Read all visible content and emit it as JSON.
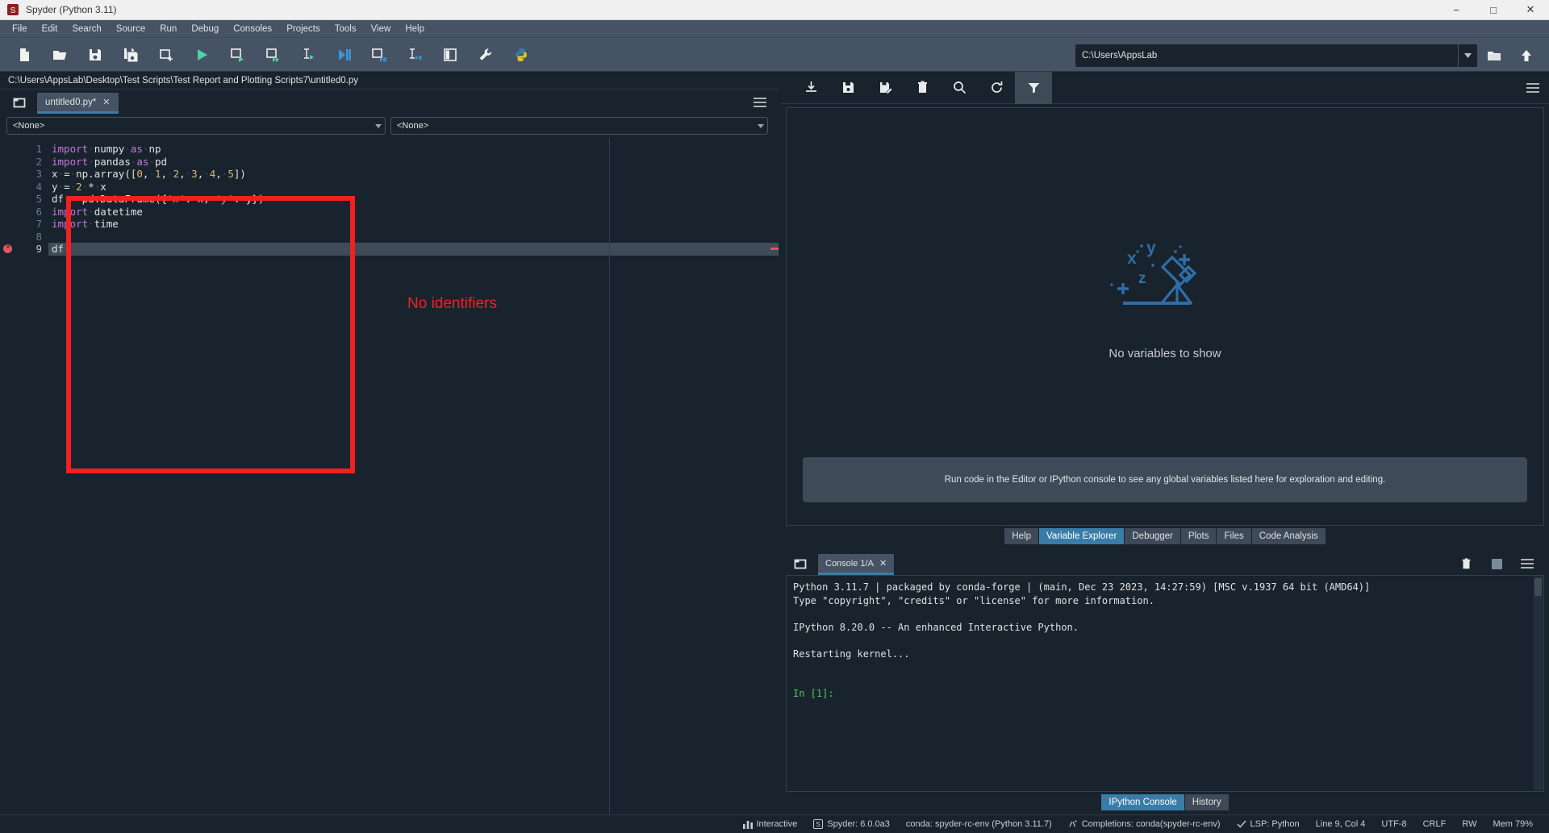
{
  "window": {
    "title": "Spyder (Python 3.11)",
    "app_icon": "spyder-icon",
    "minimize": "−",
    "maximize": "□",
    "close": "✕"
  },
  "menubar": {
    "items": [
      {
        "label": "File",
        "name": "menu-file"
      },
      {
        "label": "Edit",
        "name": "menu-edit"
      },
      {
        "label": "Search",
        "name": "menu-search"
      },
      {
        "label": "Source",
        "name": "menu-source"
      },
      {
        "label": "Run",
        "name": "menu-run"
      },
      {
        "label": "Debug",
        "name": "menu-debug"
      },
      {
        "label": "Consoles",
        "name": "menu-consoles"
      },
      {
        "label": "Projects",
        "name": "menu-projects"
      },
      {
        "label": "Tools",
        "name": "menu-tools"
      },
      {
        "label": "View",
        "name": "menu-view"
      },
      {
        "label": "Help",
        "name": "menu-help"
      }
    ]
  },
  "toolbar": {
    "buttons": [
      "new-file-icon",
      "open-file-icon",
      "save-file-icon",
      "save-all-icon",
      "new-cell-icon",
      "run-file-icon",
      "run-cell-icon",
      "run-cell-advance-icon",
      "run-selection-icon",
      "debug-file-icon",
      "debug-cell-icon",
      "debug-selection-icon",
      "maximize-pane-icon",
      "preferences-icon",
      "python-path-manager-icon"
    ],
    "path_value": "C:\\Users\\AppsLab",
    "browse_icon": "open-folder-icon",
    "parent_icon": "go-up-icon"
  },
  "editor": {
    "file_path": "C:\\Users\\AppsLab\\Desktop\\Test Scripts\\Test Report and Plotting Scripts7\\untitled0.py",
    "corner_icon": "browse-tabs-icon",
    "options_icon": "hamburger-menu-icon",
    "tab": {
      "label": "untitled0.py*",
      "close": "✕"
    },
    "class_selector": "<None>",
    "function_selector": "<None>",
    "status_line": "Line 9, Col 4",
    "lines": [
      {
        "no": "1",
        "tokens": [
          {
            "t": "import",
            "c": "kw"
          },
          {
            "t": "·",
            "c": "ind"
          },
          {
            "t": "numpy",
            "c": "pl"
          },
          {
            "t": "·",
            "c": "ind"
          },
          {
            "t": "as",
            "c": "kw"
          },
          {
            "t": "·",
            "c": "ind"
          },
          {
            "t": "np",
            "c": "pl"
          }
        ]
      },
      {
        "no": "2",
        "tokens": [
          {
            "t": "import",
            "c": "kw"
          },
          {
            "t": "·",
            "c": "ind"
          },
          {
            "t": "pandas",
            "c": "pl"
          },
          {
            "t": "·",
            "c": "ind"
          },
          {
            "t": "as",
            "c": "kw"
          },
          {
            "t": "·",
            "c": "ind"
          },
          {
            "t": "pd",
            "c": "pl"
          }
        ]
      },
      {
        "no": "3",
        "tokens": [
          {
            "t": "x",
            "c": "pl"
          },
          {
            "t": "·",
            "c": "ind"
          },
          {
            "t": "=",
            "c": "op"
          },
          {
            "t": "·",
            "c": "ind"
          },
          {
            "t": "np.array([",
            "c": "pl"
          },
          {
            "t": "0",
            "c": "num"
          },
          {
            "t": ",",
            "c": "op"
          },
          {
            "t": "·",
            "c": "ind"
          },
          {
            "t": "1",
            "c": "num"
          },
          {
            "t": ",",
            "c": "op"
          },
          {
            "t": "·",
            "c": "ind"
          },
          {
            "t": "2",
            "c": "num"
          },
          {
            "t": ",",
            "c": "op"
          },
          {
            "t": "·",
            "c": "ind"
          },
          {
            "t": "3",
            "c": "num"
          },
          {
            "t": ",",
            "c": "op"
          },
          {
            "t": "·",
            "c": "ind"
          },
          {
            "t": "4",
            "c": "num"
          },
          {
            "t": ",",
            "c": "op"
          },
          {
            "t": "·",
            "c": "ind"
          },
          {
            "t": "5",
            "c": "num"
          },
          {
            "t": "])",
            "c": "pl"
          }
        ]
      },
      {
        "no": "4",
        "tokens": [
          {
            "t": "y",
            "c": "pl"
          },
          {
            "t": "·",
            "c": "ind"
          },
          {
            "t": "=",
            "c": "op"
          },
          {
            "t": "·",
            "c": "ind"
          },
          {
            "t": "2",
            "c": "num"
          },
          {
            "t": "·",
            "c": "ind"
          },
          {
            "t": "*",
            "c": "op"
          },
          {
            "t": "·",
            "c": "ind"
          },
          {
            "t": "x",
            "c": "pl"
          }
        ]
      },
      {
        "no": "5",
        "tokens": [
          {
            "t": "df",
            "c": "pl"
          },
          {
            "t": "·",
            "c": "ind"
          },
          {
            "t": "=",
            "c": "op"
          },
          {
            "t": "·",
            "c": "ind"
          },
          {
            "t": "pd.DataFrame({",
            "c": "pl"
          },
          {
            "t": "'x'",
            "c": "str"
          },
          {
            "t": ":",
            "c": "op"
          },
          {
            "t": "·",
            "c": "ind"
          },
          {
            "t": "x,",
            "c": "pl"
          },
          {
            "t": "·",
            "c": "ind"
          },
          {
            "t": "'y'",
            "c": "str"
          },
          {
            "t": ":",
            "c": "op"
          },
          {
            "t": "·",
            "c": "ind"
          },
          {
            "t": "y})",
            "c": "pl"
          }
        ]
      },
      {
        "no": "6",
        "tokens": [
          {
            "t": "import",
            "c": "kw"
          },
          {
            "t": "·",
            "c": "ind"
          },
          {
            "t": "datetime",
            "c": "pl"
          }
        ]
      },
      {
        "no": "7",
        "tokens": [
          {
            "t": "import",
            "c": "kw"
          },
          {
            "t": "·",
            "c": "ind"
          },
          {
            "t": "time",
            "c": "pl"
          }
        ]
      },
      {
        "no": "8",
        "tokens": []
      },
      {
        "no": "9",
        "tokens": [
          {
            "t": "df.",
            "c": "pl"
          }
        ],
        "current": true,
        "error": true
      }
    ]
  },
  "annotation": {
    "label": "No identifiers",
    "color": "#f22020"
  },
  "variable_explorer": {
    "toolbar": [
      "import-data-icon",
      "save-data-icon",
      "save-data-as-icon",
      "remove-all-variables-icon",
      "search-icon",
      "refresh-icon",
      "filter-icon"
    ],
    "active_tool": "filter-icon",
    "options_icon": "hamburger-menu-icon",
    "empty_illustration": "telescope-icon",
    "empty_title": "No variables to show",
    "empty_hint": "Run code in the Editor or IPython console to see any global variables listed here for exploration and editing."
  },
  "top_pane_tabs": [
    {
      "label": "Help",
      "active": false
    },
    {
      "label": "Variable Explorer",
      "active": true
    },
    {
      "label": "Debugger",
      "active": false
    },
    {
      "label": "Plots",
      "active": false
    },
    {
      "label": "Files",
      "active": false
    },
    {
      "label": "Code Analysis",
      "active": false
    }
  ],
  "console": {
    "corner_icon": "browse-tabs-icon",
    "tab": {
      "label": "Console 1/A",
      "close": "✕"
    },
    "tools": [
      "remove-all-variables-icon",
      "interrupt-kernel-icon",
      "hamburger-menu-icon"
    ],
    "lines": [
      "Python 3.11.7 | packaged by conda-forge | (main, Dec 23 2023, 14:27:59) [MSC v.1937 64 bit (AMD64)]",
      "Type \"copyright\", \"credits\" or \"license\" for more information.",
      "",
      "IPython 8.20.0 -- An enhanced Interactive Python.",
      "",
      "Restarting kernel...",
      "",
      ""
    ],
    "prompt": "In [1]:"
  },
  "bottom_pane_tabs": [
    {
      "label": "IPython Console",
      "active": true
    },
    {
      "label": "History",
      "active": false
    }
  ],
  "statusbar": {
    "items": [
      {
        "icon": "chart-icon",
        "label": "Interactive"
      },
      {
        "icon": "spyder-icon",
        "label": "Spyder: 6.0.0a3"
      },
      {
        "icon": "",
        "label": "conda: spyder-rc-env (Python 3.11.7)"
      },
      {
        "icon": "completions-icon",
        "label": "Completions: conda(spyder-rc-env)"
      },
      {
        "icon": "check-icon",
        "label": "LSP: Python"
      },
      {
        "icon": "",
        "label": "Line 9, Col 4"
      },
      {
        "icon": "",
        "label": "UTF-8"
      },
      {
        "icon": "",
        "label": "CRLF"
      },
      {
        "icon": "",
        "label": "RW"
      },
      {
        "icon": "",
        "label": "Mem 79%"
      }
    ]
  },
  "colors": {
    "accent": "#3a7ca8",
    "panel": "#455364",
    "background": "#19232d",
    "error": "#e05561",
    "annotation": "#f22020",
    "illustration": "#3a7ca8"
  }
}
